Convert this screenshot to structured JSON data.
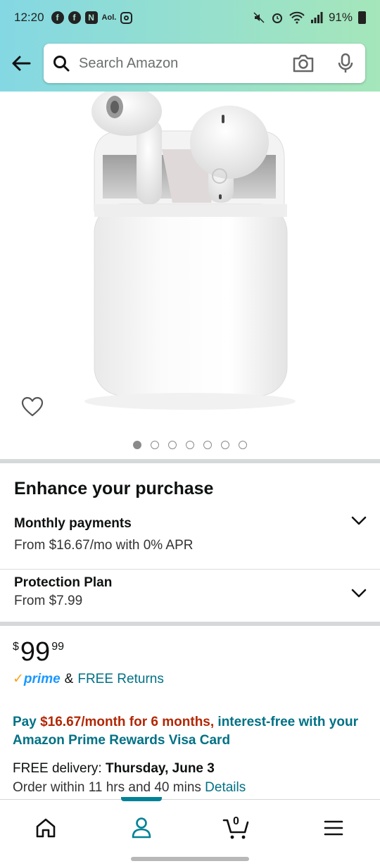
{
  "status_bar": {
    "time": "12:20",
    "battery": "91%",
    "app_icons": [
      "facebook-icon",
      "facebook-icon",
      "aol-icon",
      "instagram-icon"
    ]
  },
  "search": {
    "placeholder": "Search Amazon"
  },
  "product": {
    "image_dots_count": 7,
    "active_dot": 0
  },
  "enhance": {
    "title": "Enhance your purchase",
    "monthly_title": "Monthly payments",
    "monthly_sub": "From $16.67/mo with 0% APR",
    "protection_title": "Protection Plan",
    "protection_sub": "From $7.99"
  },
  "price": {
    "symbol": "$",
    "whole": "99",
    "fraction": "99"
  },
  "prime": {
    "check": "✓",
    "logo": "prime",
    "amp": "&",
    "returns": "FREE Returns"
  },
  "promo": {
    "prefix": "Pay ",
    "amount": "$16.67/month for 6 months,",
    "suffix": " interest-free with your Amazon Prime Rewards Visa Card"
  },
  "delivery": {
    "label": "FREE delivery: ",
    "date": "Thursday, June 3",
    "order_within": "Order within 11 hrs and 40 mins ",
    "details": "Details"
  },
  "bottom_nav": {
    "cart_count": "0",
    "items": [
      "home-icon",
      "account-icon",
      "cart-icon",
      "menu-icon"
    ],
    "active_index": 1
  },
  "colors": {
    "header_start": "#84d8e3",
    "header_end": "#a5e6ba",
    "link": "#007185",
    "price_red": "#b12704",
    "prime_blue": "#1a98ff",
    "prime_check": "#f7a21b"
  }
}
